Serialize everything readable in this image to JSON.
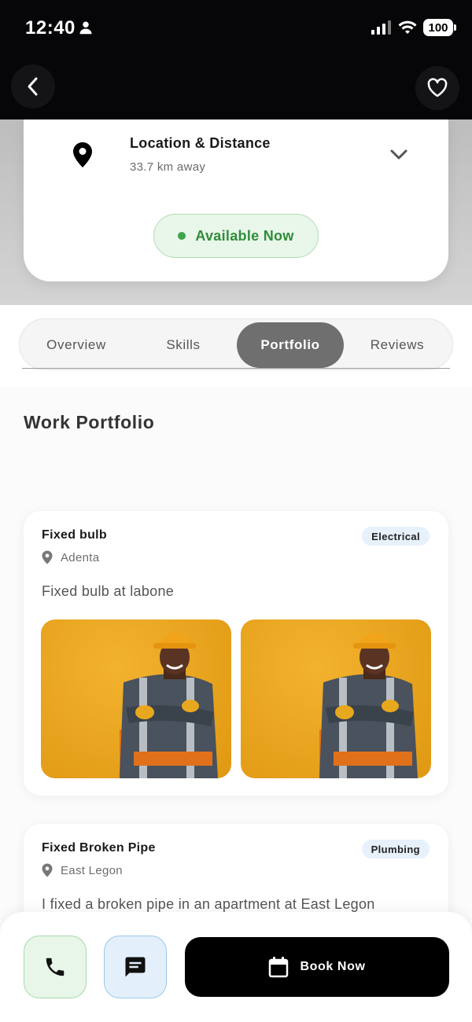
{
  "status_bar": {
    "time": "12:40",
    "battery": "100"
  },
  "location": {
    "title": "Location & Distance",
    "distance": "33.7 km away"
  },
  "availability": {
    "label": "Available Now",
    "color": "#3fa54a"
  },
  "tabs": [
    {
      "label": "Overview"
    },
    {
      "label": "Skills"
    },
    {
      "label": "Portfolio",
      "active": true
    },
    {
      "label": "Reviews"
    }
  ],
  "portfolio": {
    "heading": "Work Portfolio",
    "items": [
      {
        "title": "Fixed bulb",
        "category": "Electrical",
        "location": "Adenta",
        "description": "Fixed bulb at labone",
        "image_count": 2
      },
      {
        "title": "Fixed Broken Pipe",
        "category": "Plumbing",
        "location": "East Legon",
        "description": "I fixed a broken pipe in an apartment at East Legon"
      }
    ]
  },
  "actions": {
    "book_label": "Book Now"
  },
  "icons": {
    "back": "back-arrow-icon",
    "favorite": "heart-icon",
    "pin": "map-pin-icon",
    "chevron": "chevron-down-icon",
    "call": "phone-icon",
    "message": "chat-icon",
    "calendar": "calendar-icon"
  },
  "colors": {
    "accent": "#000000",
    "available_bg": "#e9f6ea",
    "tag_bg": "#e7f1fb"
  }
}
